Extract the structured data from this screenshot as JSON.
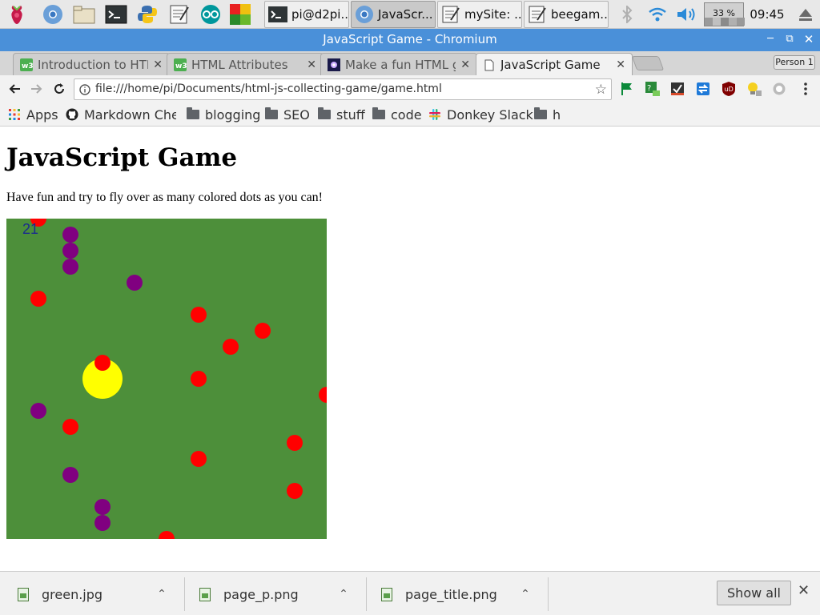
{
  "taskbar": {
    "tasks": [
      {
        "label": "pi@d2pi...",
        "icon": "terminal-icon"
      },
      {
        "label": "JavaScr...",
        "icon": "chromium-icon"
      },
      {
        "label": "mySite: ...",
        "icon": "text-editor-icon"
      },
      {
        "label": "beegam...",
        "icon": "text-editor-icon"
      }
    ],
    "cpu_label": "33 %",
    "clock": "09:45"
  },
  "window": {
    "title": "JavaScript Game - Chromium"
  },
  "tabs": [
    {
      "label": "Introduction to HTML",
      "icon": "w3schools-icon"
    },
    {
      "label": "HTML Attributes",
      "icon": "w3schools-icon"
    },
    {
      "label": "Make a fun HTML game",
      "icon": "galaxy-icon"
    },
    {
      "label": "JavaScript Game",
      "icon": "page-icon",
      "active": true
    }
  ],
  "profile": {
    "label": "Person 1"
  },
  "omnibox": {
    "url": "file:///home/pi/Documents/html-js-collecting-game/game.html"
  },
  "bookmarks": [
    {
      "label": "Apps",
      "icon": "apps-grid-icon"
    },
    {
      "label": "Markdown Cheatsheet",
      "icon": "github-icon"
    },
    {
      "label": "blogging",
      "icon": "folder-icon"
    },
    {
      "label": "SEO",
      "icon": "folder-icon"
    },
    {
      "label": "stuff",
      "icon": "folder-icon"
    },
    {
      "label": "code",
      "icon": "folder-icon"
    },
    {
      "label": "Donkey Slack",
      "icon": "slack-icon"
    },
    {
      "label": "h",
      "icon": "folder-icon"
    }
  ],
  "page": {
    "heading": "JavaScript Game",
    "paragraph": "Have fun and try to fly over as many colored dots as you can!",
    "game": {
      "score": "21",
      "colors": {
        "background": "#4d8f3a",
        "red": "#ff0000",
        "purple": "#800080",
        "player": "#ffff00"
      }
    }
  },
  "downloads": {
    "items": [
      {
        "name": "green.jpg"
      },
      {
        "name": "page_p.png"
      },
      {
        "name": "page_title.png"
      }
    ],
    "show_all": "Show all"
  }
}
